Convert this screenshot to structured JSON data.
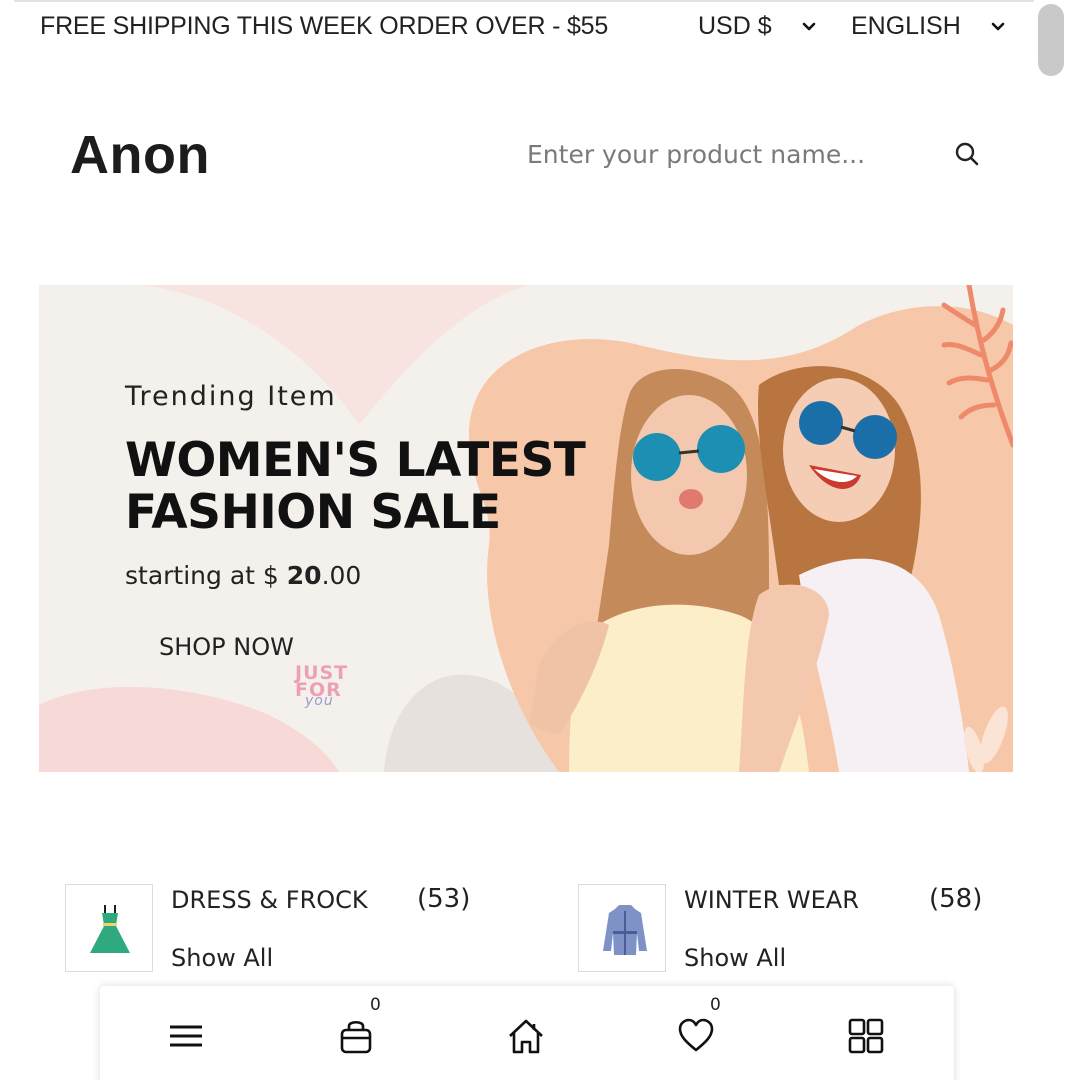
{
  "topbar": {
    "shipping_text": "FREE SHIPPING THIS WEEK ORDER OVER - $55",
    "currency": "USD $",
    "language": "ENGLISH"
  },
  "header": {
    "logo": "Anon",
    "search_placeholder": "Enter your product name..."
  },
  "banner": {
    "subtitle": "Trending Item",
    "title": "WOMEN'S LATEST FASHION SALE",
    "price_prefix": "starting at $ ",
    "price_whole": "20",
    "price_decimal": ".00",
    "cta": "SHOP NOW",
    "stamp_line1": "JUST",
    "stamp_line2": "FOR",
    "stamp_line3": "you"
  },
  "categories": [
    {
      "name": "DRESS & FROCK",
      "count": "(53)",
      "link": "Show All",
      "icon": "dress-icon"
    },
    {
      "name": "WINTER WEAR",
      "count": "(58)",
      "link": "Show All",
      "icon": "jacket-icon"
    }
  ],
  "bottom_nav": {
    "items": [
      "menu-icon",
      "bag-icon",
      "home-icon",
      "heart-icon",
      "grid-icon"
    ],
    "cart_count": "0",
    "wishlist_count": "0"
  },
  "colors": {
    "accent_peach": "#f6c7a8",
    "pink": "#f7d6d4",
    "stamp_pink": "#ee9fb8",
    "dress_green": "#2eaa7e",
    "jacket_blue": "#7f92c8"
  }
}
